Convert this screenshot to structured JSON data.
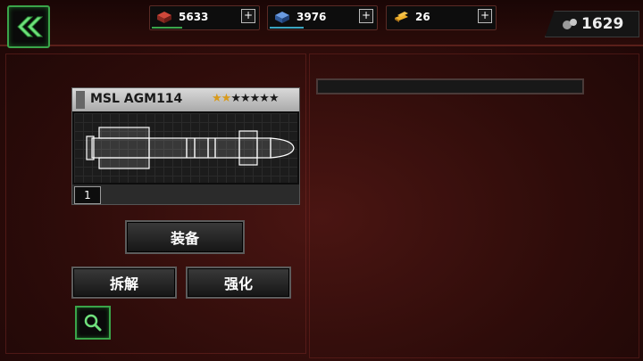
{
  "resources": [
    {
      "name": "steel",
      "icon": "steel-icon",
      "value": "5633",
      "color": "#b33a2e"
    },
    {
      "name": "crystal",
      "icon": "crystal-icon",
      "value": "3976",
      "color": "#3f6fb3"
    },
    {
      "name": "gold",
      "icon": "gold-bars-icon",
      "value": "26",
      "color": "#d89a1c"
    }
  ],
  "currency": {
    "icon": "ore-icon",
    "value": "1629"
  },
  "item": {
    "name": "MSL AGM114",
    "stars_filled": 2,
    "stars_total": 7,
    "level": "1"
  },
  "buttons": {
    "equip": "装备",
    "dismantle": "拆解",
    "enhance": "强化"
  },
  "colors": {
    "accent_green": "#3aa54a",
    "background": "#3a100e"
  }
}
